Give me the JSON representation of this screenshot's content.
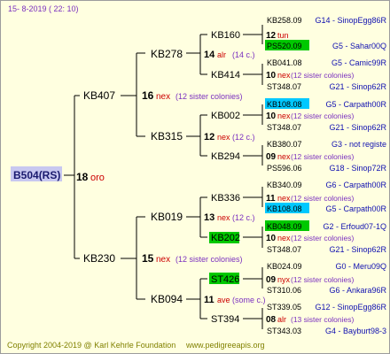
{
  "header": {
    "date": "15-  8-2019 (  22: 10)"
  },
  "footer": {
    "copyright": "Copyright 2004-2019 @ Karl Kehrle Foundation",
    "website": "www.pedigreeapis.org"
  },
  "root": {
    "code": "B504(RS)",
    "year": "18",
    "race": "oro"
  },
  "gen1": [
    {
      "code": "KB407",
      "year": "16",
      "race": "nex",
      "note": "(12 sister colonies)"
    },
    {
      "code": "KB230",
      "year": "15",
      "race": "nex",
      "note": "(12 sister colonies)"
    }
  ],
  "gen2": [
    {
      "code": "KB278",
      "year": "14",
      "race": "alr",
      "note": "(14 c.)"
    },
    {
      "code": "KB315",
      "year": "12",
      "race": "nex",
      "note": "(12 c.)"
    },
    {
      "code": "KB019",
      "year": "13",
      "race": "nex",
      "note": "(12 c.)"
    },
    {
      "code": "KB094",
      "year": "11",
      "race": "ave",
      "note": "(some c.)"
    }
  ],
  "gen3": [
    {
      "code": "KB160",
      "year": "12",
      "race": "tun",
      "note": ""
    },
    {
      "code": "KB414",
      "year": "10",
      "race": "nex",
      "note": "(12 sister colonies)"
    },
    {
      "code": "KB002",
      "year": "10",
      "race": "nex",
      "note": "(12 sister colonies)"
    },
    {
      "code": "KB294",
      "year": "09",
      "race": "nex",
      "note": "(12 sister colonies)"
    },
    {
      "code": "KB336",
      "year": "11",
      "race": "nex",
      "note": "(12 sister colonies)"
    },
    {
      "code": "KB202",
      "year": "10",
      "race": "nex",
      "note": "(12 sister colonies)"
    },
    {
      "code": "ST426",
      "year": "09",
      "race": "nyx",
      "note": "(12 sister colonies)"
    },
    {
      "code": "ST394",
      "year": "08",
      "race": "alr",
      "note": "(13 sister colonies)"
    }
  ],
  "gen4": [
    {
      "code": "KB258.09",
      "info": "G14 - SinopEgg86R"
    },
    {
      "code": "PS520.09",
      "info": "G5 - Sahar00Q"
    },
    {
      "code": "KB041.08",
      "info": "G5 - Camic99R"
    },
    {
      "code": "ST348.07",
      "info": "G21 - Sinop62R"
    },
    {
      "code": "KB108.08",
      "info": "G5 - Carpath00R"
    },
    {
      "code": "ST348.07",
      "info": "G21 - Sinop62R"
    },
    {
      "code": "KB380.07",
      "info": "G3 - not registe"
    },
    {
      "code": "PS596.06",
      "info": "G18 - Sinop72R"
    },
    {
      "code": "KB340.09",
      "info": "G6 - Carpath00R"
    },
    {
      "code": "KB108.08",
      "info": "G5 - Carpath00R"
    },
    {
      "code": "KB048.09",
      "info": "G2 - Erfoud07-1Q"
    },
    {
      "code": "ST348.07",
      "info": "G21 - Sinop62R"
    },
    {
      "code": "KB024.09",
      "info": "G0 - Meru09Q"
    },
    {
      "code": "ST310.06",
      "info": "G6 - Ankara96R"
    },
    {
      "code": "ST339.05",
      "info": "G12 - SinopEgg86R"
    },
    {
      "code": "ST343.03",
      "info": "G4 - Bayburt98-3"
    }
  ],
  "colors": {
    "background": "#ffffe0",
    "green": "#00c800",
    "cyan": "#00c8ff",
    "race_red": "#cc0000",
    "note_purple": "#7a2fbf",
    "info_blue": "#1010b0",
    "root_box": "#c8c8f0",
    "footer_olive": "#808000"
  }
}
